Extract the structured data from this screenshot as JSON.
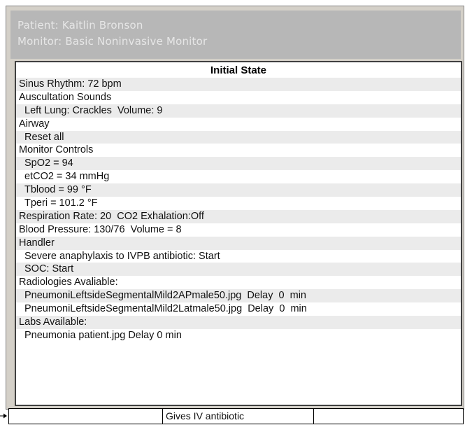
{
  "header": {
    "patient_line": "Patient: Kaitlin Bronson",
    "monitor_line": "Monitor: Basic Noninvasive Monitor"
  },
  "state_panel": {
    "title": "Initial State",
    "rows": [
      {
        "text": "Sinus Rhythm: 72 bpm",
        "indent": false
      },
      {
        "text": "Auscultation Sounds",
        "indent": false
      },
      {
        "text": "Left Lung: Crackles  Volume: 9",
        "indent": true
      },
      {
        "text": "Airway",
        "indent": false
      },
      {
        "text": "Reset all",
        "indent": true
      },
      {
        "text": "Monitor Controls",
        "indent": false
      },
      {
        "text": "SpO2 = 94",
        "indent": true
      },
      {
        "text": "etCO2 = 34 mmHg",
        "indent": true
      },
      {
        "text": "Tblood = 99 °F",
        "indent": true
      },
      {
        "text": "Tperi = 101.2 °F",
        "indent": true
      },
      {
        "text": "Respiration Rate: 20  CO2 Exhalation:Off",
        "indent": false
      },
      {
        "text": "Blood Pressure: 130/76  Volume = 8",
        "indent": false
      },
      {
        "text": "Handler",
        "indent": false
      },
      {
        "text": "Severe anaphylaxis to IVPB antibiotic: Start",
        "indent": true
      },
      {
        "text": "SOC: Start",
        "indent": true
      },
      {
        "text": "Radiologies Avaliable:",
        "indent": false
      },
      {
        "text": "PneumoniLeftsideSegmentalMild2APmale50.jpg  Delay  0  min",
        "indent": true
      },
      {
        "text": "PneumoniLeftsideSegmentalMild2Latmale50.jpg  Delay  0  min",
        "indent": true
      },
      {
        "text": "Labs Available:",
        "indent": false
      },
      {
        "text": "Pneumonia patient.jpg Delay 0 min",
        "indent": true
      }
    ]
  },
  "bottom_bar": {
    "left_cell": "",
    "center_cell": "Gives IV antibiotic",
    "right_cell": ""
  },
  "icons": {
    "arrow_marker": "arrow-right-icon"
  }
}
